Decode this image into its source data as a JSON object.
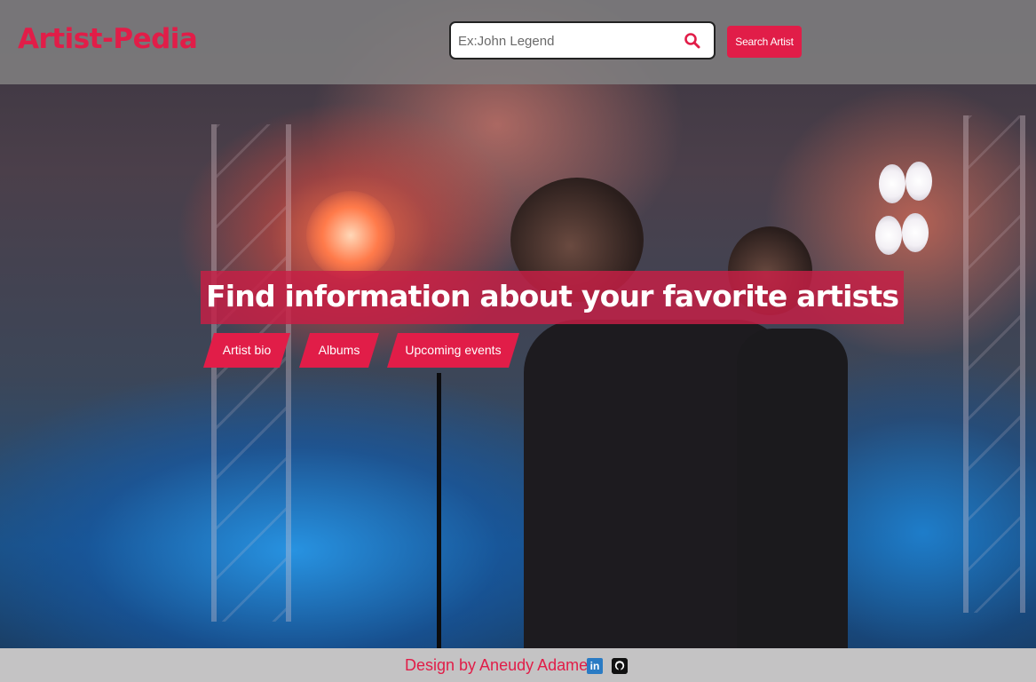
{
  "brand": {
    "logo_text": "Artist-Pedia",
    "accent_color": "#e11d48"
  },
  "search": {
    "placeholder": "Ex:John Legend",
    "value": "",
    "icon": "search-icon",
    "button_label": "Search Artist"
  },
  "hero": {
    "headline": "Find information about your favorite artists",
    "tags": [
      {
        "label": "Artist bio"
      },
      {
        "label": "Albums"
      },
      {
        "label": "Upcoming events"
      }
    ]
  },
  "footer": {
    "credit": "Design by Aneudy Adames",
    "social_icons": [
      "linkedin-icon",
      "github-icon"
    ]
  }
}
